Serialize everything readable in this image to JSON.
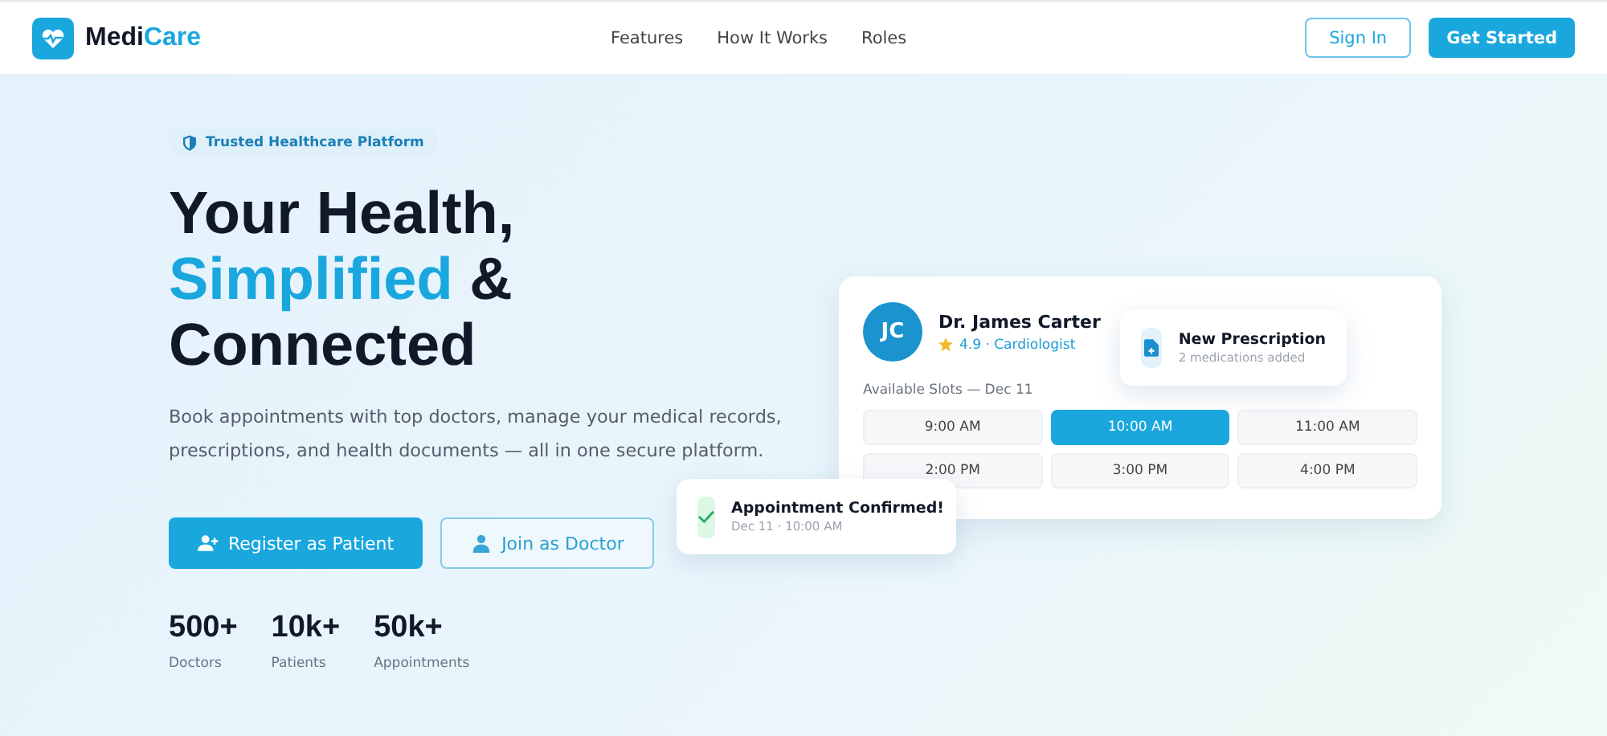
{
  "nav": {
    "brand": {
      "first": "Medi",
      "second": "Care"
    },
    "links": [
      "Features",
      "How It Works",
      "Roles"
    ],
    "sign_in": "Sign In",
    "get_started": "Get Started"
  },
  "hero": {
    "badge": "Trusted Healthcare Platform",
    "headline": {
      "line_1": "Your Health,",
      "accent": "Simplified",
      "line_2_rest": "&",
      "line_3": "Connected"
    },
    "description": "Book appointments with top doctors, manage your medical records, prescriptions, and health documents — all in one secure platform.",
    "primary_button": "Register as Patient",
    "secondary_button": "Join as Doctor",
    "stats": [
      {
        "value": "500+",
        "label": "Doctors"
      },
      {
        "value": "10k+",
        "label": "Patients"
      },
      {
        "value": "50k+",
        "label": "Appointments"
      }
    ]
  },
  "doctor_card": {
    "initials": "JC",
    "name": "Dr. James Carter",
    "rating": "4.9 · Cardiologist",
    "slots_label": "Available Slots — Dec 11",
    "slots": [
      {
        "time": "9:00 AM",
        "selected": false
      },
      {
        "time": "10:00 AM",
        "selected": true
      },
      {
        "time": "11:00 AM",
        "selected": false
      },
      {
        "time": "2:00 PM",
        "selected": false
      },
      {
        "time": "3:00 PM",
        "selected": false
      },
      {
        "time": "4:00 PM",
        "selected": false
      }
    ]
  },
  "prescription_popup": {
    "title": "New Prescription",
    "subtitle": "2 medications added"
  },
  "confirmation_toast": {
    "title": "Appointment Confirmed!",
    "subtitle": "Dec 11 · 10:00 AM"
  }
}
